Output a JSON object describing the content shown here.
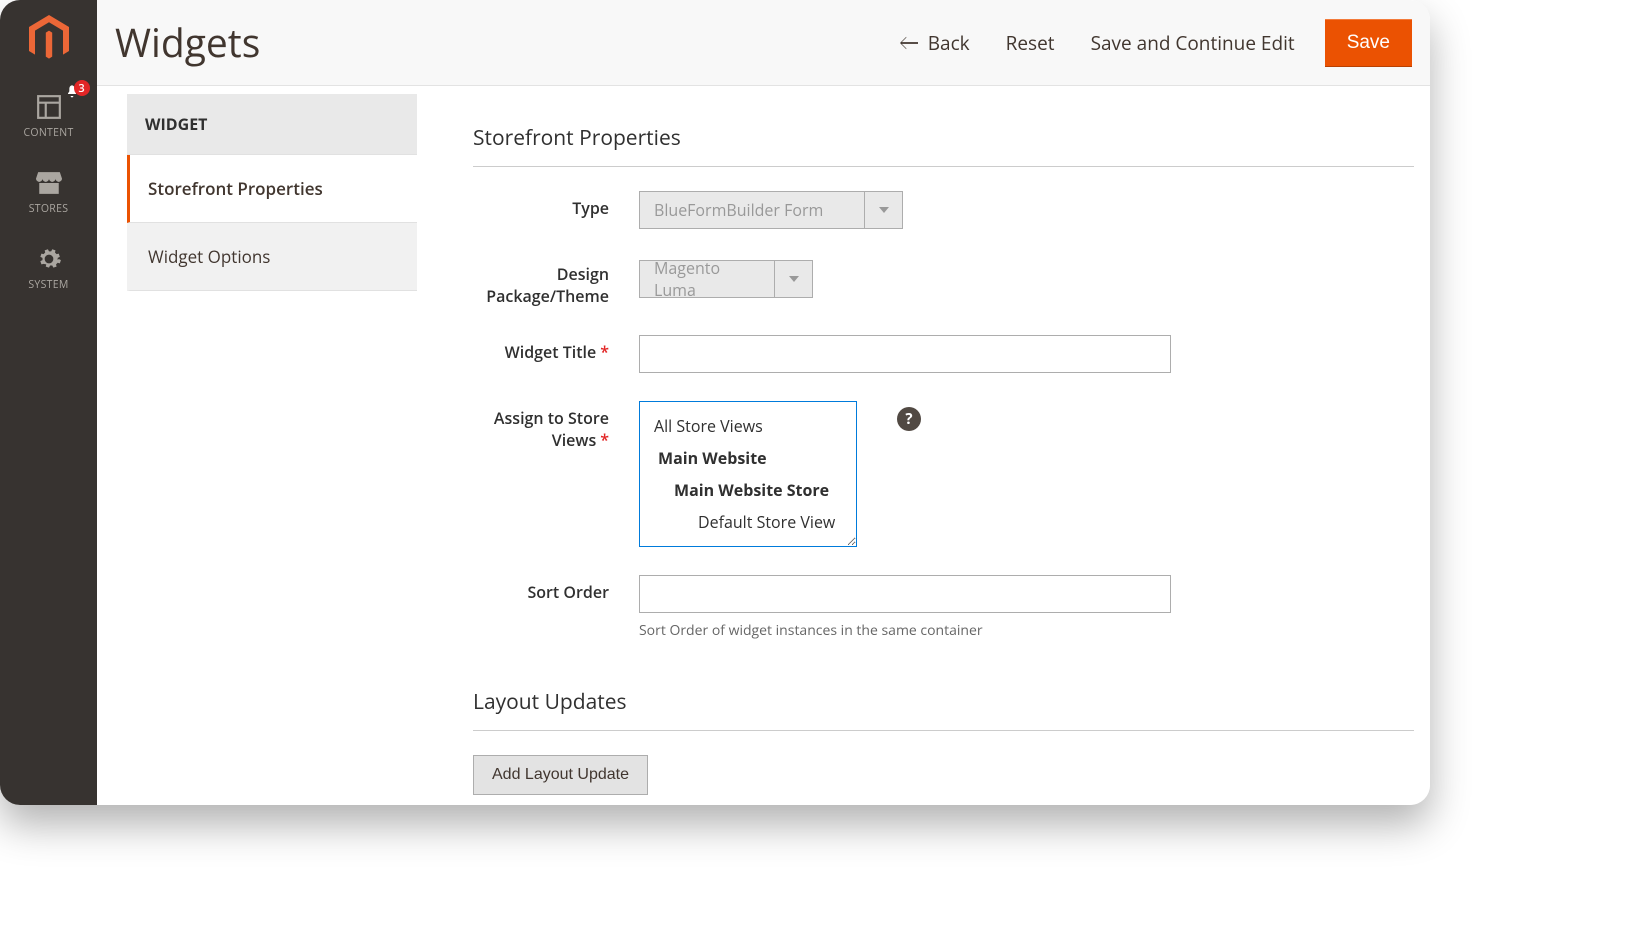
{
  "header": {
    "title": "Widgets",
    "back_label": "Back",
    "reset_label": "Reset",
    "save_continue_label": "Save and Continue Edit",
    "save_label": "Save"
  },
  "sidebar": {
    "items": [
      {
        "id": "content",
        "label": "CONTENT",
        "notif_count": "3"
      },
      {
        "id": "stores",
        "label": "STORES"
      },
      {
        "id": "system",
        "label": "SYSTEM"
      }
    ]
  },
  "tabs": {
    "header": "WIDGET",
    "items": [
      {
        "label": "Storefront Properties",
        "active": true
      },
      {
        "label": "Widget Options",
        "active": false
      }
    ]
  },
  "form": {
    "section1_title": "Storefront Properties",
    "type_label": "Type",
    "type_value": "BlueFormBuilder Form",
    "theme_label": "Design Package/Theme",
    "theme_value": "Magento Luma",
    "title_label": "Widget Title",
    "title_value": "",
    "storeviews_label": "Assign to Store Views",
    "storeviews_options": {
      "all": "All Store Views",
      "website": "Main Website",
      "store": "Main Website Store",
      "view": "Default Store View"
    },
    "sortorder_label": "Sort Order",
    "sortorder_value": "",
    "sortorder_note": "Sort Order of widget instances in the same container",
    "section2_title": "Layout Updates",
    "add_layout_label": "Add Layout Update"
  }
}
